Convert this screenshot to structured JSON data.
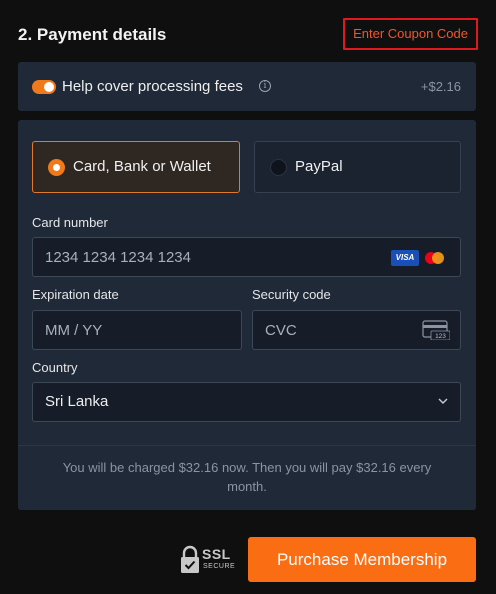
{
  "header": {
    "title": "2. Payment details",
    "coupon_link": "Enter Coupon Code"
  },
  "fees": {
    "toggle_on": true,
    "label": "Help cover processing fees",
    "amount": "+$2.16"
  },
  "payment_methods": [
    {
      "label": "Card, Bank or Wallet",
      "selected": true
    },
    {
      "label": "PayPal",
      "selected": false
    }
  ],
  "card_form": {
    "card_number_label": "Card number",
    "card_number_placeholder": "1234 1234 1234 1234",
    "card_brand_badge": "VISA",
    "expiration_label": "Expiration date",
    "expiration_placeholder": "MM / YY",
    "security_label": "Security code",
    "security_placeholder": "CVC",
    "cvc_icon_text": "123",
    "country_label": "Country",
    "country_value": "Sri Lanka"
  },
  "notice": "You will be charged $32.16 now. Then you will pay $32.16 every month.",
  "footer": {
    "ssl_title": "SSL",
    "ssl_subtitle": "SECURE",
    "purchase_button": "Purchase Membership"
  },
  "colors": {
    "accent": "#fa6d12",
    "coupon_border": "#e0191f",
    "panel": "#1f2937",
    "background": "#0f0f0f"
  }
}
